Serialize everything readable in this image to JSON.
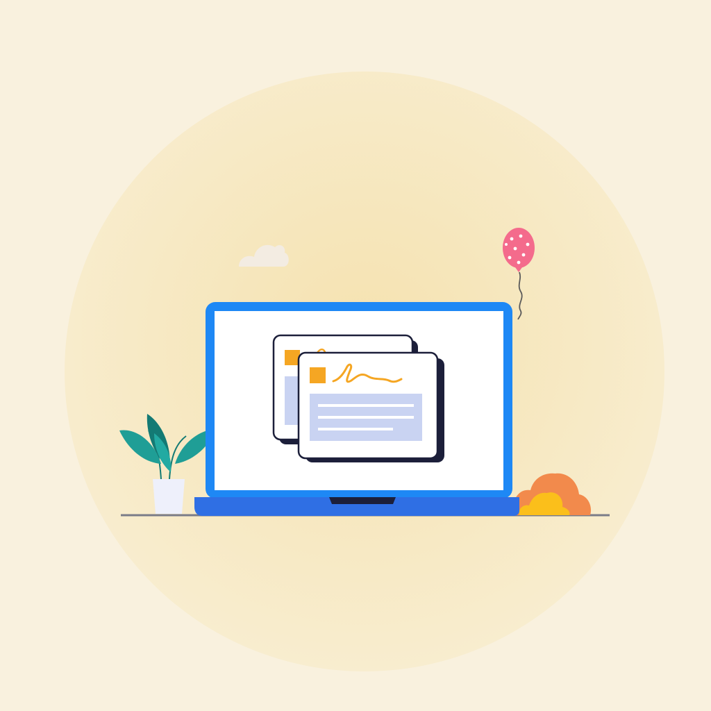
{
  "illustration": {
    "subject": "laptop-with-signed-documents",
    "icons": [
      "laptop-icon",
      "document-card-icon",
      "signature-icon",
      "plant-icon",
      "balloon-icon",
      "cloud-icon",
      "bush-icon"
    ]
  },
  "colors": {
    "background": "#f9f1de",
    "halo_outer": "#f8edcf",
    "halo_inner": "#f5e2b0",
    "laptop_frame": "#1e88f5",
    "laptop_base": "#2f6fe4",
    "laptop_notch": "#1c1f3a",
    "screen": "#ffffff",
    "card_fill": "#ffffff",
    "card_outline": "#1c1f3a",
    "card_square": "#f5a623",
    "signature": "#f5a623",
    "card_content": "#c9d3f2",
    "card_lines": "#ffffff",
    "plant_leaf": "#1f9e96",
    "plant_leaf_dark": "#137a74",
    "plant_pot": "#eef0fb",
    "balloon": "#f46b8c",
    "balloon_dots": "#ffffff",
    "balloon_string": "#5a5a5a",
    "cloud": "#f3ece2",
    "bush_back": "#f28a4c",
    "bush_front": "#fbbf1b",
    "ground_line": "#7a7c88"
  }
}
